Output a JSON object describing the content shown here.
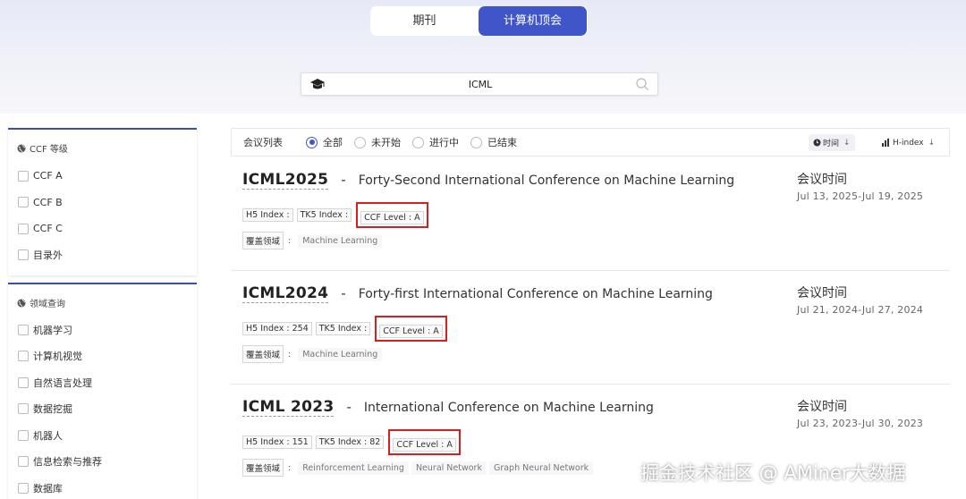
{
  "tabs": [
    {
      "label": "期刊"
    },
    {
      "label": "计算机顶会"
    }
  ],
  "search": {
    "value": "ICML",
    "placeholder": ""
  },
  "sidebar": {
    "ccf": {
      "title": "CCF 等级",
      "items": [
        "CCF A",
        "CCF B",
        "CCF C",
        "目录外"
      ]
    },
    "domain": {
      "title": "领域查询",
      "items": [
        "机器学习",
        "计算机视觉",
        "自然语言处理",
        "数据挖掘",
        "机器人",
        "信息检索与推荐",
        "数据库"
      ]
    }
  },
  "filter": {
    "label": "会议列表",
    "options": [
      "全部",
      "未开始",
      "进行中",
      "已结束"
    ],
    "selected": "全部",
    "sort_time": "时间",
    "sort_hindex": "H-index"
  },
  "conferences": [
    {
      "abbr": "ICML2025",
      "dash": "-",
      "name": "Forty-Second International Conference on Machine Learning",
      "h5": "H5 Index :",
      "tk5": "TK5 Index :",
      "ccf": "CCF Level : A",
      "field_label": "覆盖领域",
      "fields": [
        "Machine Learning"
      ],
      "time_label": "会议时间",
      "time": "Jul 13, 2025-Jul 19, 2025"
    },
    {
      "abbr": "ICML2024",
      "dash": "-",
      "name": "Forty-first International Conference on Machine Learning",
      "h5": "H5 Index : 254",
      "tk5": "TK5 Index :",
      "ccf": "CCF Level : A",
      "field_label": "覆盖领域",
      "fields": [
        "Machine Learning"
      ],
      "time_label": "会议时间",
      "time": "Jul 21, 2024-Jul 27, 2024"
    },
    {
      "abbr": "ICML 2023",
      "dash": "-",
      "name": "International Conference on Machine Learning",
      "h5": "H5 Index : 151",
      "tk5": "TK5 Index : 82",
      "ccf": "CCF Level : A",
      "field_label": "覆盖领域",
      "fields": [
        "Reinforcement Learning",
        "Neural Network",
        "Graph Neural Network"
      ],
      "time_label": "会议时间",
      "time": "Jul 23, 2023-Jul 30, 2023"
    }
  ],
  "colors": {
    "accent": "#3f55c8",
    "highlight": "#d81e1e"
  },
  "watermark": "掘金技术社区 @ AMiner大数据"
}
